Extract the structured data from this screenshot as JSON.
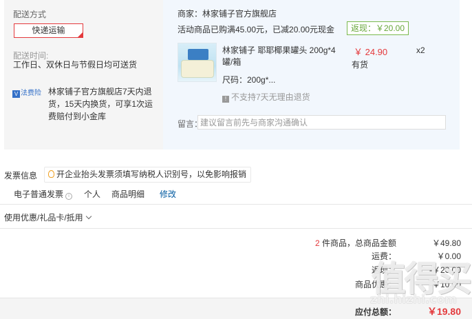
{
  "shipping": {
    "title": "配送方式",
    "method_button": "快递运输",
    "time_label": "配送时间:",
    "time_value": "工作日、双休日与节假日均可送货",
    "insurance_tag": "法费险",
    "insurance_text": "林家铺子官方旗舰店7天内退货，15天内换货，可享1次运费赔付到小金库"
  },
  "store": {
    "name": "商家：林家铺子官方旗舰店",
    "promo": "活动商品已购满45.00元，已减20.00元现金",
    "rebate": "返现：￥20.00"
  },
  "product": {
    "name": "林家铺子 耶耶椰果罐头 200g*4罐/箱",
    "price": "￥ 24.90",
    "stock": "有货",
    "qty": "x2",
    "size": "尺码：200g*...",
    "no_return": "不支持7天无理由退货"
  },
  "message": {
    "label": "留言：",
    "placeholder": "建议留言前先与商家沟通确认"
  },
  "invoice": {
    "title": "发票信息",
    "tip": "开企业抬头发票须填写纳税人识别号，以免影响报销",
    "type": "电子普通发票",
    "personal": "个人",
    "detail": "商品明细",
    "modify": "修改"
  },
  "coupon": {
    "label": "使用优惠/礼品卡/抵用"
  },
  "summary": {
    "count": "2",
    "count_label": "件商品，总商品金额",
    "total": "￥49.80",
    "shipping_label": "运费：",
    "shipping": "￥0.00",
    "discount_label": "返现：",
    "discount": "-￥20.00",
    "reduce_label": "商品优惠：",
    "reduce": "-￥10.00",
    "pay_label": "应付总额：",
    "pay": "￥19.80"
  },
  "watermark": {
    "big": "值得买",
    "small": "zhi.hizhi.com"
  }
}
